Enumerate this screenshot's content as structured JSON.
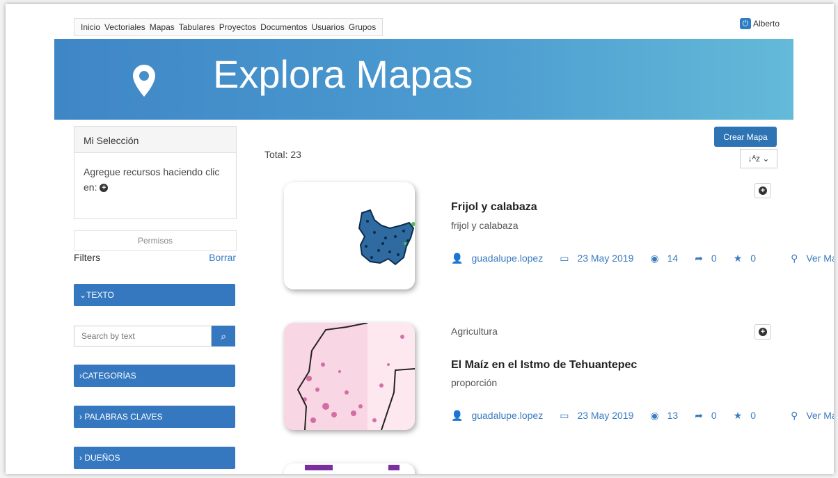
{
  "nav": {
    "items": [
      "Inicio",
      "Vectoriales",
      "Mapas",
      "Tabulares",
      "Proyectos",
      "Documentos",
      "Usuarios",
      "Grupos"
    ],
    "user": "Alberto"
  },
  "banner": {
    "title": "Explora Mapas"
  },
  "sidebar": {
    "selection_title": "Mi Selección",
    "selection_text": "Agregue recursos haciendo clic en:",
    "permisos": "Permisos",
    "filters_label": "Filters",
    "clear_label": "Borrar",
    "texto": "TEXTO",
    "search_placeholder": "Search by text",
    "categorias": "CATEGORÍAS",
    "palabras": "PALABRAS CLAVES",
    "duenos": "DUEÑOS"
  },
  "main": {
    "total": "Total: 23",
    "create_label": "Crear Mapa",
    "items": [
      {
        "category": "",
        "title": "Frijol y calabaza",
        "subtitle": "frijol y calabaza",
        "owner": "guadalupe.lopez",
        "date": "23 May 2019",
        "views": "14",
        "shares": "0",
        "rating": "0",
        "link": "Ver Mapa"
      },
      {
        "category": "Agricultura",
        "title": "El Maíz en el Istmo de Tehuantepec",
        "subtitle": "proporción",
        "owner": "guadalupe.lopez",
        "date": "23 May 2019",
        "views": "13",
        "shares": "0",
        "rating": "0",
        "link": "Ver Mapa"
      }
    ]
  },
  "colors": {
    "banner_start": "#3f86c6",
    "banner_end": "#64bad8",
    "accent": "#3578c0"
  }
}
